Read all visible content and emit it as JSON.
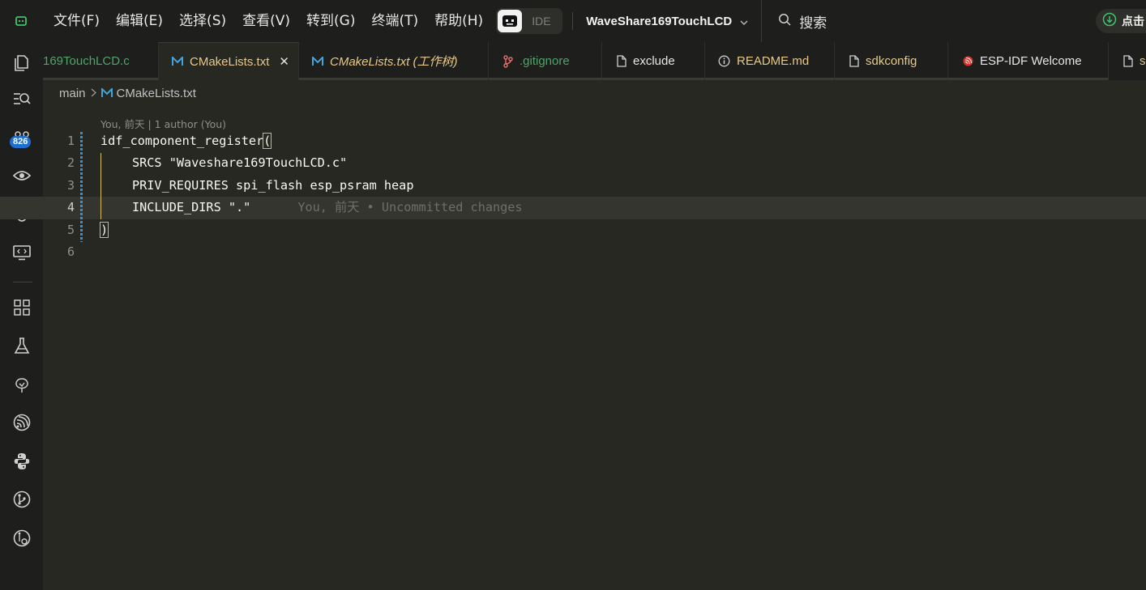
{
  "menu": [
    "文件(F)",
    "编辑(E)",
    "选择(S)",
    "查看(V)",
    "转到(G)",
    "终端(T)",
    "帮助(H)"
  ],
  "mode_toggle": {
    "label": "IDE"
  },
  "project_name": "WaveShare169TouchLCD",
  "search_label": "搜索",
  "right_pill_label": "点击",
  "activity_badge": "826",
  "tabs": [
    {
      "label": "169TouchLCD.c",
      "color": "#4fa36b",
      "icon": "none"
    },
    {
      "label": "CMakeLists.txt",
      "color": "#e7c88a",
      "icon": "cmake-m-icon",
      "active": true
    },
    {
      "label": "CMakeLists.txt (工作树)",
      "color": "#e7c88a",
      "icon": "cmake-m-icon",
      "italic": true
    },
    {
      "label": ".gitignore",
      "color": "#4fa36b",
      "icon": "git-branch-icon"
    },
    {
      "label": "exclude",
      "color": "#e6e6e6",
      "icon": "file-icon"
    },
    {
      "label": "README.md",
      "color": "#e7c88a",
      "icon": "info-icon"
    },
    {
      "label": "sdkconfig",
      "color": "#e7c88a",
      "icon": "file-icon"
    },
    {
      "label": "ESP-IDF Welcome",
      "color": "#e6e6e6",
      "icon": "espressif-icon"
    },
    {
      "label": "s",
      "color": "#e7c88a",
      "icon": "file-icon"
    }
  ],
  "breadcrumb": {
    "folder": "main",
    "file": "CMakeLists.txt"
  },
  "codelens": "You, 前天 | 1 author (You)",
  "line_numbers": [
    "1",
    "2",
    "3",
    "4",
    "5",
    "6"
  ],
  "code": {
    "l1_fn": "idf_component_register",
    "l1_paren": "(",
    "l2": "SRCS \"Waveshare169TouchLCD.c\"",
    "l3": "PRIV_REQUIRES spi_flash esp_psram heap",
    "l4": "INCLUDE_DIRS \".\"",
    "l4_blame": "You, 前天 • Uncommitted changes",
    "l5": ")",
    "l6": ""
  }
}
